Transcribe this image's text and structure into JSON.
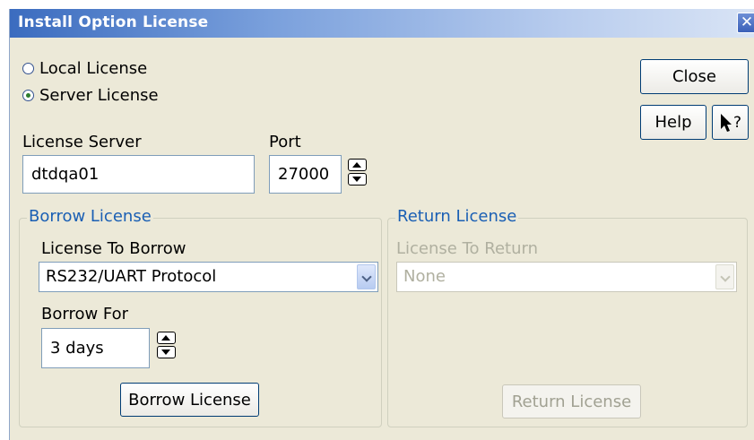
{
  "window": {
    "title": "Install Option License",
    "close_glyph": "✕"
  },
  "license_type": {
    "local_label": "Local License",
    "server_label": "Server License",
    "selected": "server"
  },
  "buttons": {
    "close": "Close",
    "help": "Help",
    "whats_this_glyph": "?",
    "borrow": "Borrow License",
    "return": "Return License"
  },
  "server": {
    "label": "License Server",
    "value": "dtdqa01",
    "port_label": "Port",
    "port_value": "27000"
  },
  "borrow": {
    "group_title": "Borrow License",
    "license_label": "License To Borrow",
    "license_value": "RS232/UART Protocol",
    "for_label": "Borrow For",
    "for_value": "3 days"
  },
  "return": {
    "group_title": "Return License",
    "license_label": "License To Return",
    "license_value": "None"
  },
  "icons": {
    "close": "close-icon",
    "cursor": "pointer-question-icon",
    "spin_up": "arrow-up-icon",
    "spin_down": "arrow-down-icon",
    "dropdown": "chevron-down-icon"
  }
}
